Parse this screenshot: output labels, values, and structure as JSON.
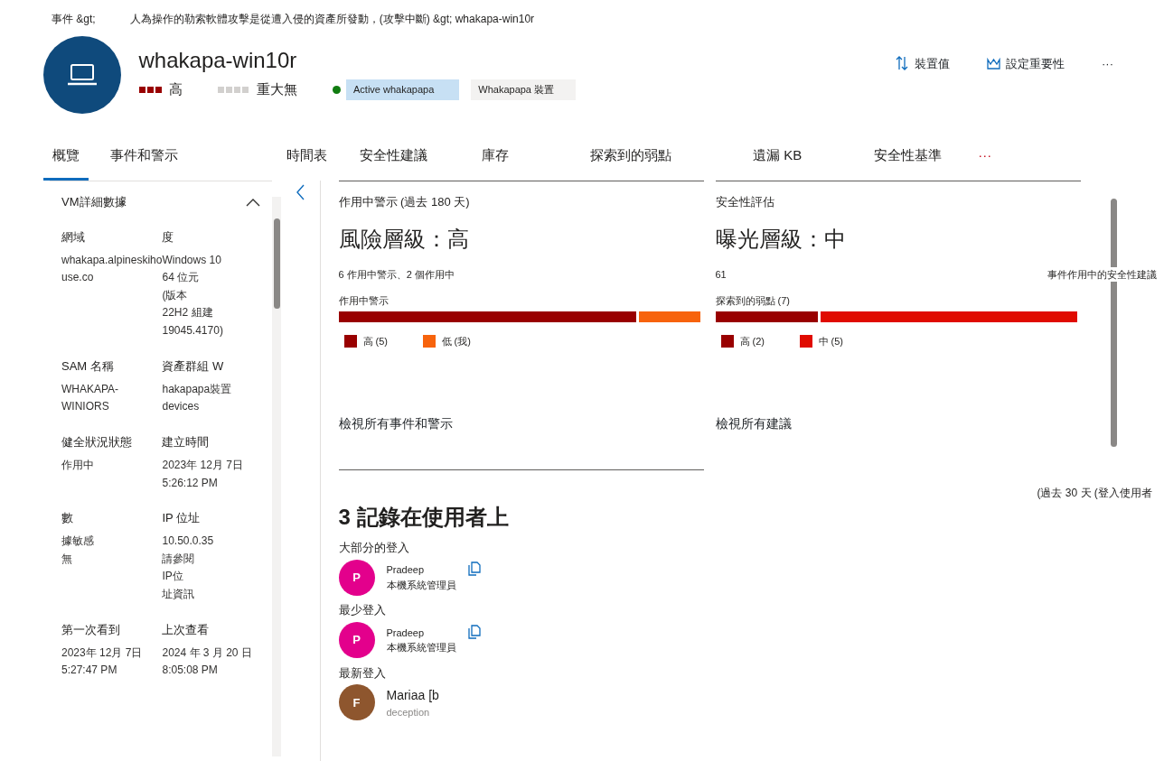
{
  "breadcrumb": [
    "事件 &gt;",
    "人為操作的勒索軟體攻擊是從遭入侵的資產所發動，(攻擊中斷) &gt; whakapa-win10r"
  ],
  "device": {
    "name": "whakapa-win10r",
    "risk": {
      "label": "高",
      "squares": [
        {
          "filled": true
        },
        {
          "filled": true
        },
        {
          "filled": true
        }
      ]
    },
    "exposure": {
      "label": "重大無",
      "squares": [
        {
          "filled": false
        },
        {
          "filled": false
        },
        {
          "filled": false
        },
        {
          "filled": false
        }
      ]
    },
    "tags": [
      {
        "label": "Active whakapapa",
        "kind": "status",
        "color": "#107c10"
      },
      {
        "label": "Whakapapa 裝置",
        "kind": "plain"
      }
    ]
  },
  "actions": [
    {
      "label": "裝置值",
      "kind": "sort"
    },
    {
      "label": "設定重要性",
      "kind": "crown"
    },
    {
      "label": "···",
      "kind": "more"
    }
  ],
  "tabs": [
    {
      "label": "概覽",
      "selected": true
    },
    {
      "label": "事件和警示",
      "selected": false
    },
    {
      "label": "時間表",
      "selected": false
    },
    {
      "label": "安全性建議",
      "selected": false
    },
    {
      "label": "庫存",
      "selected": false
    },
    {
      "label": "探索到的弱點",
      "selected": false
    },
    {
      "label": "遺漏 KB",
      "selected": false
    },
    {
      "label": "安全性基準",
      "selected": false
    },
    {
      "label": "···",
      "selected": false
    }
  ],
  "details": {
    "title": "VM詳細數據",
    "expanded": true,
    "rows": [
      [
        {
          "label": "網域",
          "lines": [
            "whakapa.alpineskihouse.co"
          ]
        },
        {
          "label": "度",
          "lines": [
            "Windows 10",
            "64 位元",
            "(版本",
            "22H2 組建",
            "19045.4170)"
          ]
        }
      ],
      [
        {
          "label": "SAM 名稱",
          "lines": [
            "WHAKAPA-",
            "WINIORS"
          ]
        },
        {
          "label": "資產群組 W",
          "lines": [
            "hakapapa裝置",
            "devices"
          ]
        }
      ],
      [
        {
          "label": "健全狀況狀態",
          "lines": [
            "作用中"
          ]
        },
        {
          "label": "建立時間",
          "lines": [
            "2023年 12月 7日",
            "5:26:12 PM"
          ]
        }
      ],
      [
        {
          "label": "數",
          "lines": [
            "據敏感",
            "無"
          ]
        },
        {
          "label": "IP 位址",
          "lines": [
            "10.50.0.35",
            "請參閱",
            "IP位",
            "址資訊"
          ]
        }
      ],
      [
        {
          "label": "第一次看到",
          "lines": [
            "2023年 12月 7日",
            "5:27:47 PM"
          ]
        },
        {
          "label": "上次查看",
          "lines": [
            "2024 年 3 月 20 日",
            "8:05:08 PM"
          ]
        }
      ]
    ]
  },
  "cards": [
    {
      "title": "作用中警示 (過去 180 天)",
      "heading": "風險層級：高",
      "summary": "6 作用中警示、2 個作用中",
      "bar_label": "作用中警示",
      "segments": [
        {
          "label": "高 (5)",
          "color": "#990000",
          "level": 0.83
        },
        {
          "label": "低 (我)",
          "color": "#f7630c",
          "level": 0.17
        }
      ],
      "link": "檢視所有事件和警示"
    },
    {
      "title": "安全性評估",
      "heading": "曝光層級：中",
      "summary": "61",
      "summary_right": "事件作用中的安全性建議",
      "bar_label": "探索到的弱點 (7)",
      "segments": [
        {
          "label": "高 (2)",
          "color": "#990000",
          "level": 0.285
        },
        {
          "label": "中 (5)",
          "color": "#e00b00",
          "level": 0.715
        }
      ],
      "link": "檢視所有建議"
    }
  ],
  "logons": {
    "period": "(過去 30 天 (登入使用者",
    "heading": "3 記錄在使用者上",
    "groups": [
      {
        "label": "大部分的登入",
        "user": {
          "initial": "P",
          "name": "Pradeep",
          "role": "本機系統管理員",
          "color": "#e3008c",
          "copy": true
        }
      },
      {
        "label": "最少登入",
        "user": {
          "initial": "P",
          "name": "Pradeep",
          "role": "本機系統管理員",
          "color": "#e3008c",
          "copy": true
        }
      },
      {
        "label": "最新登入",
        "user": {
          "initial": "F",
          "name": "Mariaa [b",
          "role": "deception",
          "color": "#8e562e",
          "copy": false
        }
      }
    ]
  }
}
